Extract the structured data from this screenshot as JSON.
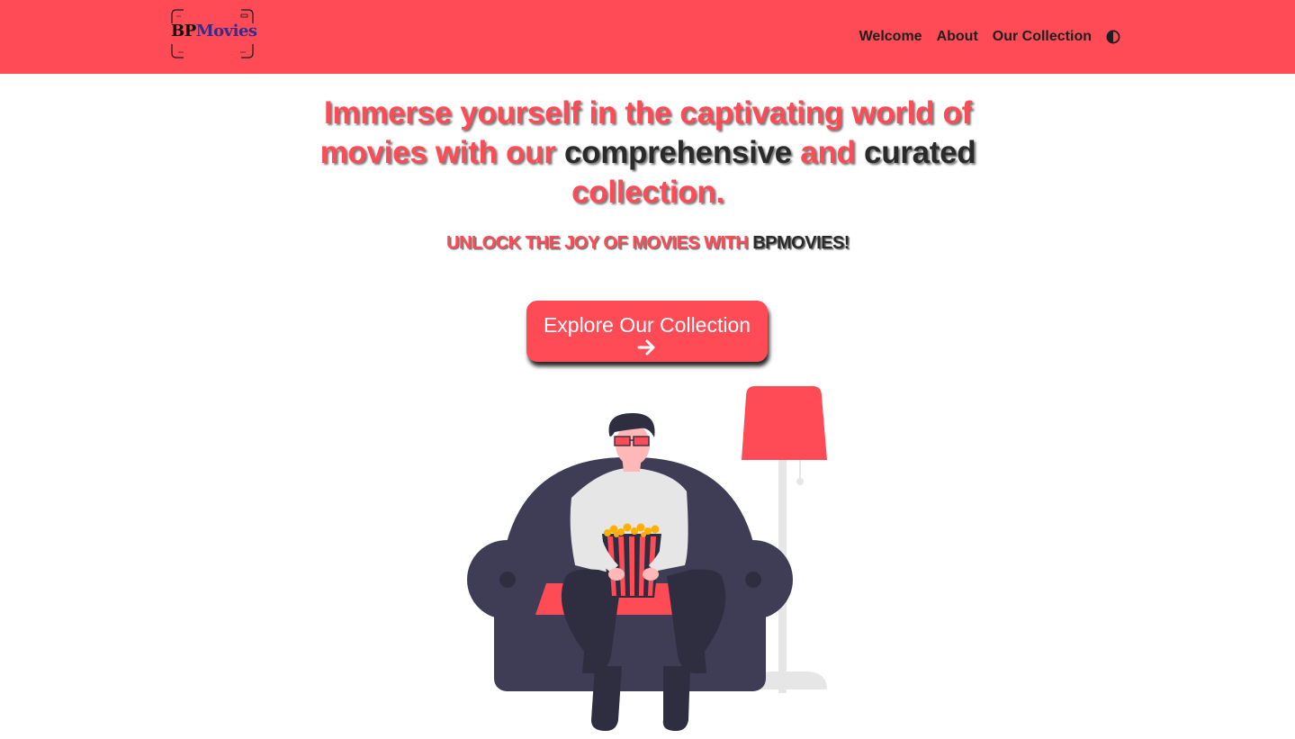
{
  "brand": {
    "name_part1": "BP",
    "name_part2": "Movies"
  },
  "nav": {
    "items": [
      {
        "label": "Welcome"
      },
      {
        "label": "About"
      },
      {
        "label": "Our Collection"
      }
    ],
    "theme_toggle_icon": "half-circle-contrast-icon"
  },
  "hero": {
    "title_parts": [
      {
        "text": "Immerse yourself in the captivating world of movies with our ",
        "color": "red"
      },
      {
        "text": "comprehensive",
        "color": "dark"
      },
      {
        "text": " and ",
        "color": "red"
      },
      {
        "text": "curated",
        "color": "dark"
      },
      {
        "text": " collection.",
        "color": "red"
      }
    ],
    "subtitle_part1": "UNLOCK THE JOY OF MOVIES WITH ",
    "subtitle_part2": "BPMOVIES!",
    "cta_label": "Explore Our Collection",
    "cta_icon": "arrow-right-icon"
  },
  "colors": {
    "accent": "#ff4b55",
    "dark_text": "#2a2a2a",
    "sofa": "#3f3d56",
    "lamp_pole": "#e6e6e6"
  }
}
